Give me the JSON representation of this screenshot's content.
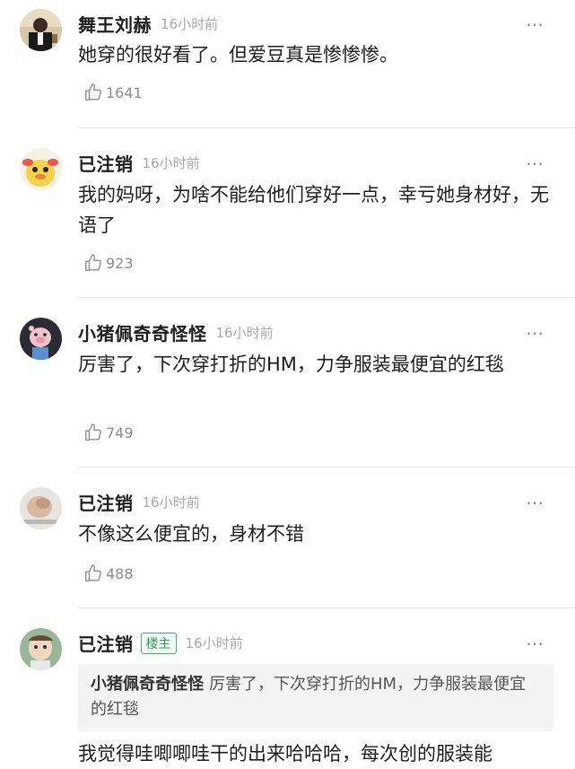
{
  "comments": [
    {
      "username": "舞王刘赫",
      "time": "16小时前",
      "text": "她穿的很好看了。但爱豆真是惨惨惨。",
      "likes": "1641",
      "avatar": "avatar-photo-man-suit"
    },
    {
      "username": "已注销",
      "time": "16小时前",
      "text": "我的妈呀，为啥不能给他们穿好一点，幸亏她身材好，无语了",
      "likes": "923",
      "avatar": "avatar-cartoon-duck"
    },
    {
      "username": "小猪佩奇奇怪怪",
      "time": "16小时前",
      "text": "厉害了，下次穿打折的HM，力争服装最便宜的红毯",
      "likes": "749",
      "avatar": "avatar-pig-figure"
    },
    {
      "username": "已注销",
      "time": "16小时前",
      "text": "不像这么便宜的，身材不错",
      "likes": "488",
      "avatar": "avatar-photo-hand"
    },
    {
      "username": "已注销",
      "badge": "楼主",
      "time": "16小时前",
      "quote_user": "小猪佩奇奇怪怪",
      "quote_text": "厉害了，下次穿打折的HM，力争服装最便宜的红毯",
      "text": "我觉得哇唧唧哇干的出来哈哈哈，每次创的服装能",
      "avatar": "avatar-photo-baby"
    }
  ],
  "more_icon": "⋯",
  "colors": {
    "badge_green": "#2ea35b",
    "muted_text": "#a8a8a8",
    "like_gray": "#8d8d8d"
  }
}
